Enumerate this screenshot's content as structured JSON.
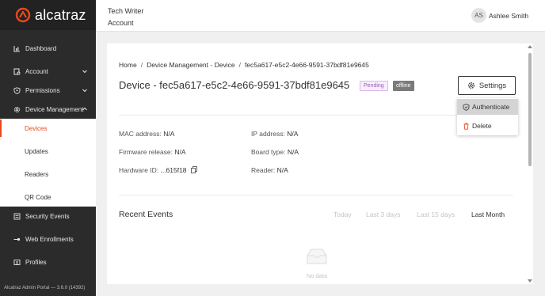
{
  "brand": {
    "name": "alcatraz"
  },
  "sidebar": {
    "items": [
      {
        "label": "Dashboard",
        "icon": "chart-icon"
      },
      {
        "label": "Account",
        "icon": "account-icon"
      },
      {
        "label": "Permissions",
        "icon": "shield-icon"
      },
      {
        "label": "Device Management",
        "icon": "gear-icon"
      },
      {
        "label": "Security Events",
        "icon": "list-icon"
      },
      {
        "label": "Web Enrollments",
        "icon": "key-icon"
      },
      {
        "label": "Profiles",
        "icon": "profile-icon"
      }
    ],
    "subitems": [
      {
        "label": "Devices",
        "active": true
      },
      {
        "label": "Updates"
      },
      {
        "label": "Readers"
      },
      {
        "label": "QR Code"
      }
    ],
    "version": "Alcatraz Admin Portal — 3.6.0 (14392)"
  },
  "header": {
    "title": "Tech Writer",
    "subtitle": "Account",
    "avatar_initials": "AS",
    "user_name": "Ashlee Smith"
  },
  "breadcrumb": [
    "Home",
    "Device Management - Device",
    "fec5a617-e5c2-4e66-9591-37bdf81e9645"
  ],
  "device": {
    "title": "Device - fec5a617-e5c2-4e66-9591-37bdf81e9645",
    "status_badge": "Pending",
    "connection_badge": "offline",
    "settings_label": "Settings",
    "fields": {
      "mac_label": "MAC address:",
      "mac_value": "N/A",
      "ip_label": "IP address:",
      "ip_value": "N/A",
      "firmware_label": "Firmware release:",
      "firmware_value": "N/A",
      "board_label": "Board type:",
      "board_value": "N/A",
      "hardware_label": "Hardware ID:",
      "hardware_value": "...615f18",
      "reader_label": "Reader:",
      "reader_value": "N/A"
    }
  },
  "dropdown": {
    "items": [
      {
        "label": "Authenticate",
        "icon": "shield-check-icon"
      },
      {
        "label": "Delete",
        "icon": "trash-icon"
      }
    ]
  },
  "recent_events": {
    "title": "Recent Events",
    "ranges": [
      "Today",
      "Last 3 days",
      "Last 15 days",
      "Last Month"
    ],
    "selected_range": "Last Month",
    "empty_text": "No data"
  },
  "colors": {
    "accent": "#e8491d",
    "sidebar_bg": "#2b2b2b",
    "pending": "#9b59b6",
    "offline": "#7a7a7a"
  }
}
